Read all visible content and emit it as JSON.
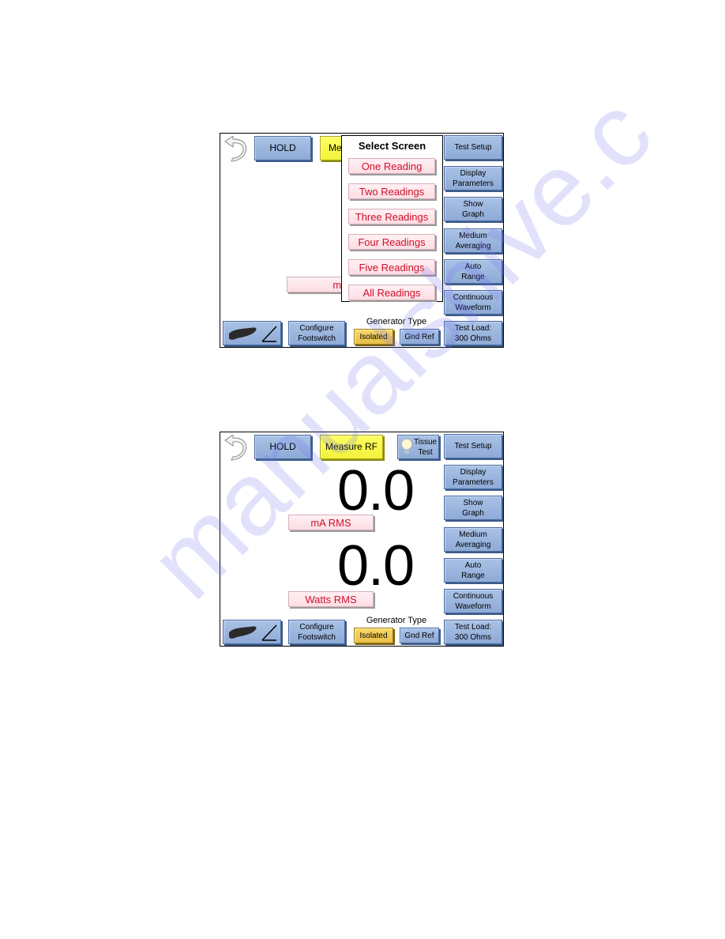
{
  "screen1": {
    "hold_label": "HOLD",
    "measure_label_partial": "Me",
    "popup": {
      "title": "Select Screen",
      "options": [
        "One Reading",
        "Two Readings",
        "Three Readings",
        "Four Readings",
        "Five Readings",
        "All Readings"
      ]
    },
    "unit_label_partial": "mA RM",
    "right_buttons": [
      {
        "line1": "Test Setup",
        "line2": ""
      },
      {
        "line1": "Display",
        "line2": "Parameters"
      },
      {
        "line1": "Show",
        "line2": "Graph"
      },
      {
        "line1": "Medium",
        "line2": "Averaging"
      },
      {
        "line1": "Auto",
        "line2": "Range"
      },
      {
        "line1": "Continuous",
        "line2": "Waveform"
      },
      {
        "line1": "Test Load:",
        "line2": "300 Ohms"
      }
    ],
    "configure": {
      "line1": "Configure",
      "line2": "Footswitch"
    },
    "generator_type_label": "Generator Type",
    "generator_options": {
      "isolated": "Isolated",
      "gnd_ref": "Gnd Ref"
    },
    "generator_selected": "Isolated"
  },
  "screen2": {
    "hold_label": "HOLD",
    "measure_label": "Measure RF",
    "tissue": {
      "line1": "Tissue",
      "line2": "Test"
    },
    "readings": [
      {
        "value": "0.0",
        "unit": "mA RMS"
      },
      {
        "value": "0.0",
        "unit": "Watts RMS"
      }
    ],
    "right_buttons": [
      {
        "line1": "Test Setup",
        "line2": ""
      },
      {
        "line1": "Display",
        "line2": "Parameters"
      },
      {
        "line1": "Show",
        "line2": "Graph"
      },
      {
        "line1": "Medium",
        "line2": "Averaging"
      },
      {
        "line1": "Auto",
        "line2": "Range"
      },
      {
        "line1": "Continuous",
        "line2": "Waveform"
      },
      {
        "line1": "Test Load:",
        "line2": "300 Ohms"
      }
    ],
    "configure": {
      "line1": "Configure",
      "line2": "Footswitch"
    },
    "generator_type_label": "Generator Type",
    "generator_options": {
      "isolated": "Isolated",
      "gnd_ref": "Gnd Ref"
    },
    "generator_selected": "Isolated"
  },
  "watermark": "manualshive.c",
  "colors": {
    "button_blue": "#9bb5e0",
    "measure_yellow": "#ffff50",
    "selected_gold": "#f0cc58",
    "unit_pink": "#fde4ea",
    "unit_text_red": "#d0102a"
  }
}
